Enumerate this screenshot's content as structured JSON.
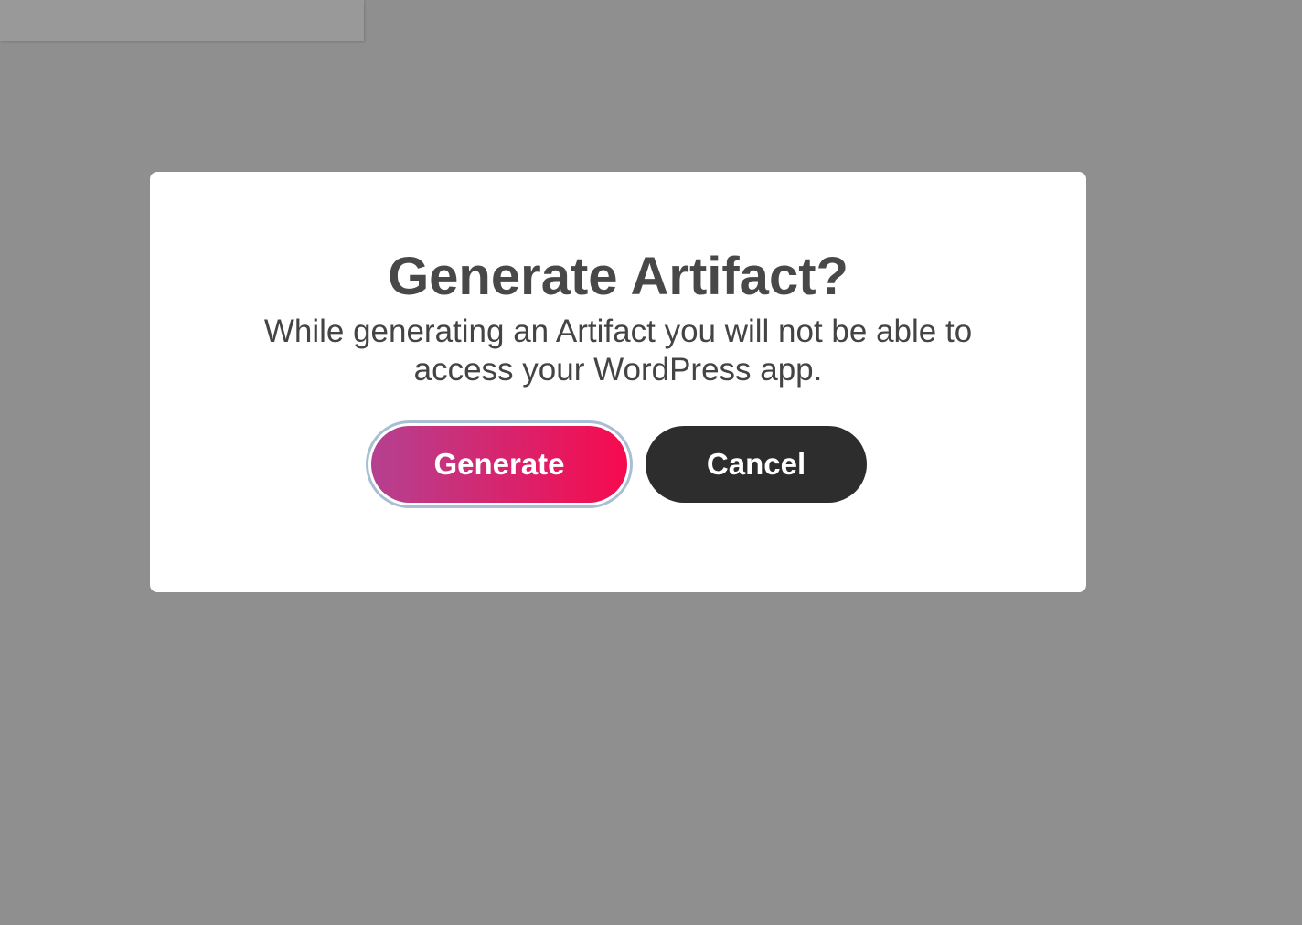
{
  "dialog": {
    "title": "Generate Artifact?",
    "message": "While generating an Artifact you will not be able to access your WordPress app.",
    "generate_label": "Generate",
    "cancel_label": "Cancel"
  },
  "colors": {
    "overlay": "#8f8f8f",
    "gradient_start": "#b44190",
    "gradient_end": "#f70a4e",
    "cancel": "#2d2d2d"
  }
}
